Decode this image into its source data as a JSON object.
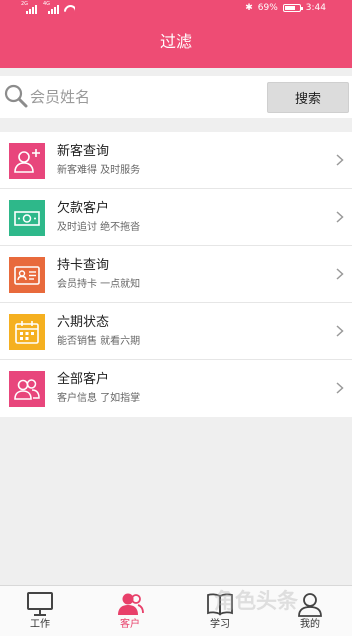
{
  "status_bar": {
    "battery": "69%",
    "time": "3:44",
    "signal_1_label": "2G",
    "signal_2_label": "4G"
  },
  "header": {
    "title": "过滤"
  },
  "search": {
    "placeholder": "会员姓名",
    "value": "",
    "button_label": "搜索"
  },
  "menu": {
    "items": [
      {
        "title": "新客查询",
        "subtitle": "新客难得 及时服务",
        "icon": "add-user-icon",
        "color": "#e8467c"
      },
      {
        "title": "欠款客户",
        "subtitle": "及时追讨 绝不拖沓",
        "icon": "banknote-icon",
        "color": "#2eb88a"
      },
      {
        "title": "持卡查询",
        "subtitle": "会员持卡 一点就知",
        "icon": "id-card-icon",
        "color": "#e86a3c"
      },
      {
        "title": "六期状态",
        "subtitle": "能否销售 就看六期",
        "icon": "calendar-icon",
        "color": "#f5b020"
      },
      {
        "title": "全部客户",
        "subtitle": "客户信息 了如指掌",
        "icon": "users-icon",
        "color": "#e8467c"
      }
    ]
  },
  "tabbar": {
    "tabs": [
      {
        "label": "工作",
        "icon": "monitor-icon"
      },
      {
        "label": "客户",
        "icon": "customers-icon",
        "active": true
      },
      {
        "label": "学习",
        "icon": "book-icon"
      },
      {
        "label": "我的",
        "icon": "profile-icon"
      }
    ],
    "active_color": "#e8406a"
  },
  "watermark": {
    "text": "角色头条"
  },
  "colors": {
    "brand": "#ee4c74"
  }
}
